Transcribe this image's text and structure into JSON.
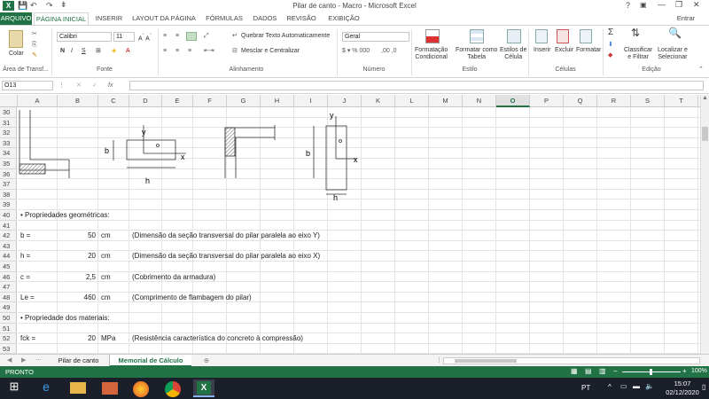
{
  "window": {
    "title": "Pilar de canto - Macro - Microsoft Excel",
    "help": "?",
    "user": "Entrar"
  },
  "tabs": {
    "file": "ARQUIVO",
    "items": [
      "PÁGINA INICIAL",
      "INSERIR",
      "LAYOUT DA PÁGINA",
      "FÓRMULAS",
      "DADOS",
      "REVISÃO",
      "EXIBIÇÃO"
    ]
  },
  "ribbon": {
    "paste": "Colar",
    "clipboard": "Área de Transf...",
    "font_name": "Calibri",
    "font_size": "11",
    "bold": "N",
    "italic": "I",
    "underline": "S",
    "font_group": "Fonte",
    "wrap_text": "Quebrar Texto Automaticamente",
    "merge": "Mesclar e Centralizar",
    "align_group": "Alinhamento",
    "number_format": "Geral",
    "number_group": "Número",
    "cond_format": "Formatação\nCondicional",
    "format_table": "Formatar como\nTabela",
    "cell_styles": "Estilos de\nCélula",
    "style_group": "Estilo",
    "insert": "Inserir",
    "delete": "Excluir",
    "format": "Formatar",
    "cells_group": "Células",
    "sort": "Classificar\ne Filtrar",
    "find": "Localizar e\nSelecionar",
    "edit_group": "Edição"
  },
  "formula_bar": {
    "name_box": "O13",
    "fx": "fx",
    "content": ""
  },
  "columns": [
    "A",
    "B",
    "C",
    "D",
    "E",
    "F",
    "G",
    "H",
    "I",
    "J",
    "K",
    "L",
    "M",
    "N",
    "O",
    "P",
    "Q",
    "R",
    "S",
    "T"
  ],
  "active_column": "O",
  "rows": [
    "30",
    "31",
    "32",
    "33",
    "34",
    "35",
    "36",
    "37",
    "38",
    "39",
    "40",
    "41",
    "42",
    "43",
    "44",
    "45",
    "46",
    "47",
    "48",
    "49",
    "50",
    "51",
    "52",
    "53"
  ],
  "diagram_labels": {
    "y1": "y",
    "x1": "x",
    "b1": "b",
    "h1": "h",
    "y2": "y",
    "x2": "x",
    "b2": "b",
    "h2": "h"
  },
  "cells": [
    {
      "row": "40",
      "col": "A",
      "text": "• Propriedades geométricas:"
    },
    {
      "row": "42",
      "col": "A",
      "text": "b ="
    },
    {
      "row": "42",
      "col": "B",
      "text": "50"
    },
    {
      "row": "42",
      "col": "C",
      "text": "cm"
    },
    {
      "row": "42",
      "col": "D",
      "text": "(Dimensão da seção transversal do pilar paralela ao eixo Y)"
    },
    {
      "row": "44",
      "col": "A",
      "text": "h ="
    },
    {
      "row": "44",
      "col": "B",
      "text": "20"
    },
    {
      "row": "44",
      "col": "C",
      "text": "cm"
    },
    {
      "row": "44",
      "col": "D",
      "text": "(Dimensão da seção transversal do pilar paralela ao eixo X)"
    },
    {
      "row": "46",
      "col": "A",
      "text": "c ="
    },
    {
      "row": "46",
      "col": "B",
      "text": "2,5"
    },
    {
      "row": "46",
      "col": "C",
      "text": "cm"
    },
    {
      "row": "46",
      "col": "D",
      "text": "(Cobrimento da armadura)"
    },
    {
      "row": "48",
      "col": "A",
      "text": "Le ="
    },
    {
      "row": "48",
      "col": "B",
      "text": "460"
    },
    {
      "row": "48",
      "col": "C",
      "text": "cm"
    },
    {
      "row": "48",
      "col": "D",
      "text": "(Comprimento de flambagem do pilar)"
    },
    {
      "row": "50",
      "col": "A",
      "text": "• Propriedade dos materiais:"
    },
    {
      "row": "52",
      "col": "A",
      "text": "fck ="
    },
    {
      "row": "52",
      "col": "B",
      "text": "20"
    },
    {
      "row": "52",
      "col": "C",
      "text": "MPa"
    },
    {
      "row": "52",
      "col": "D",
      "text": "(Resistência característica do concreto à compressão)"
    }
  ],
  "sheets": {
    "tab1": "Pilar de canto",
    "tab2": "Memorial de Cálculo",
    "add": "⊕"
  },
  "status": {
    "ready": "PRONTO",
    "zoom": "100%"
  },
  "taskbar": {
    "lang": "PT",
    "time": "15:07",
    "date": "02/12/2020"
  }
}
